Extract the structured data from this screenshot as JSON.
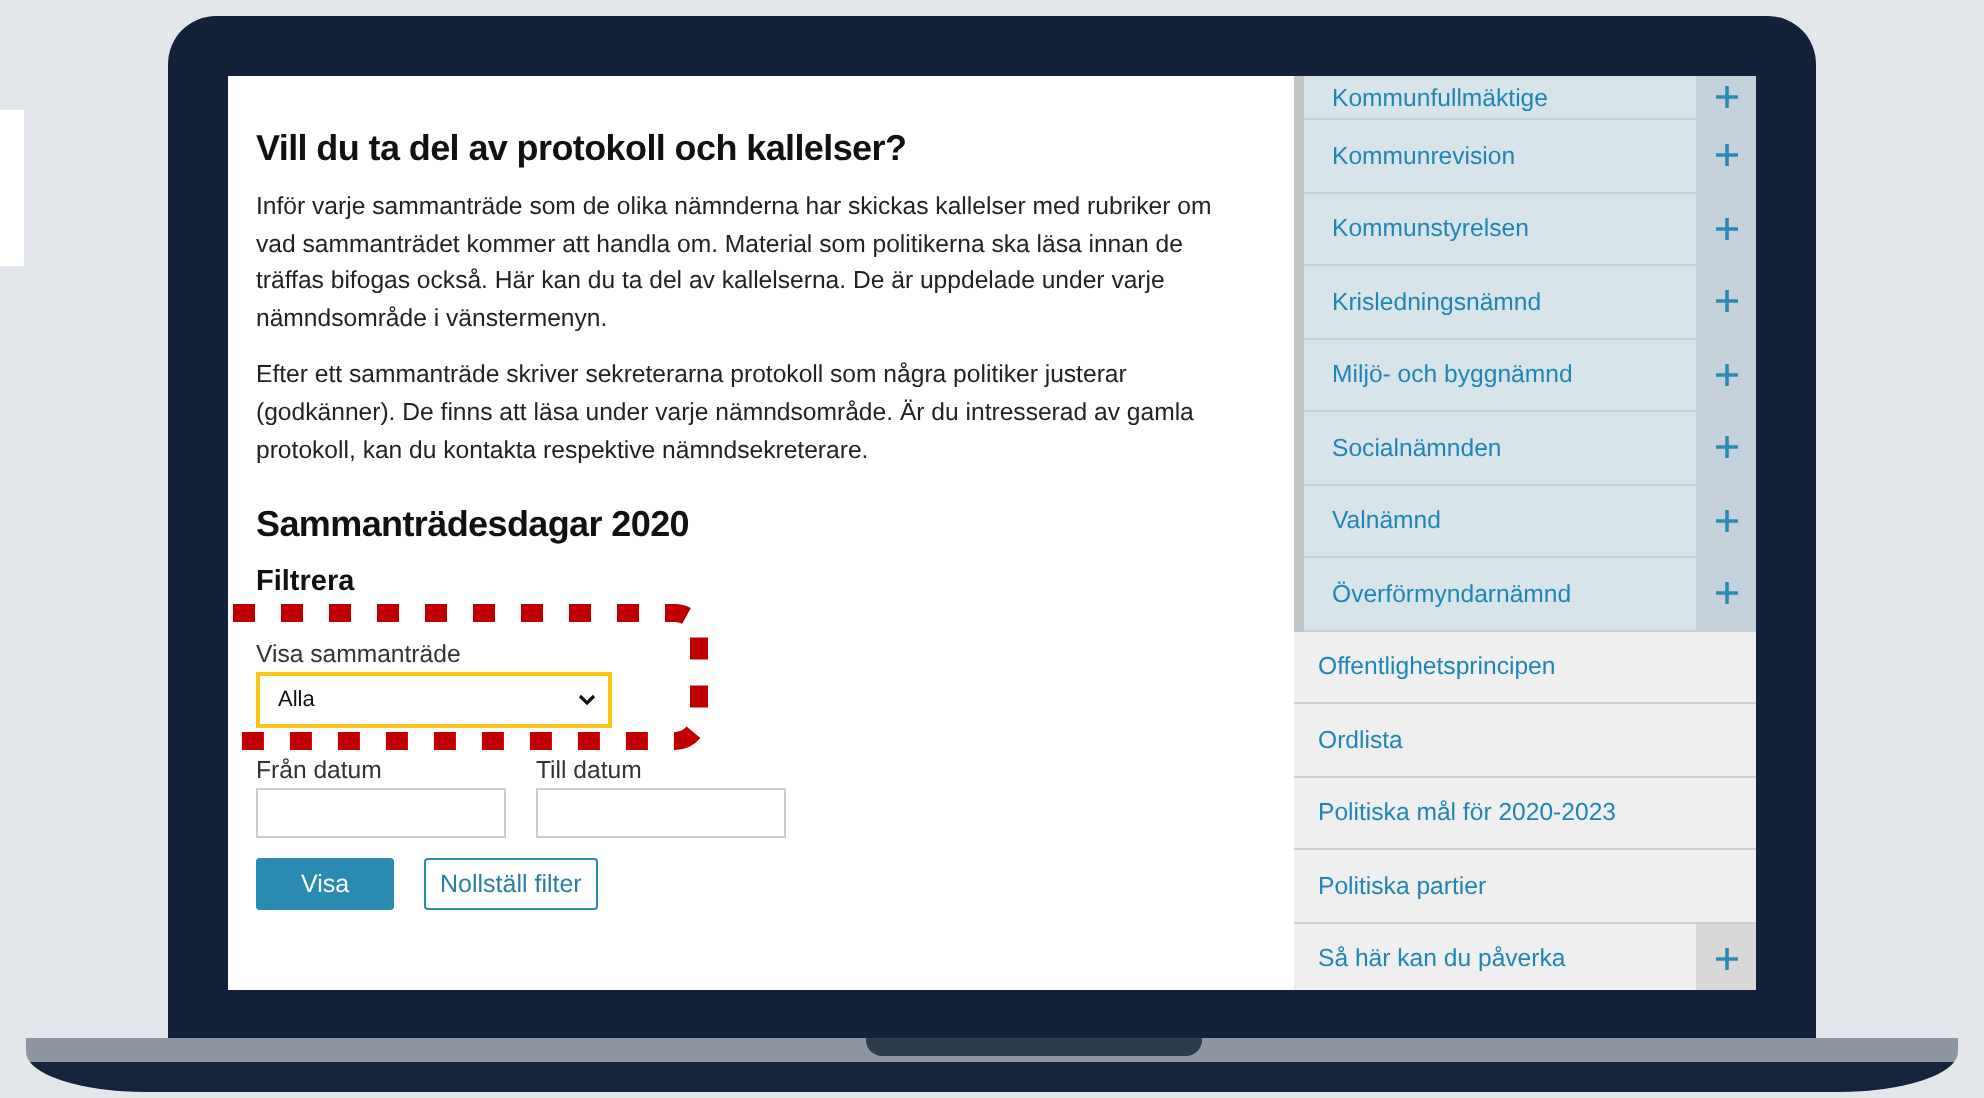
{
  "article": {
    "heading": "Vill du ta del av protokoll och kallelser?",
    "paragraphs": [
      "Inför varje sammanträde som de olika nämnderna har skickas kallelser med rubriker om vad sammanträdet kommer att handla om. Material som politikerna ska läsa innan de träffas bifogas också. Här kan du ta del av kallelserna. De är uppdelade under varje nämndsområde i vänstermenyn.",
      "Efter ett sammanträde skriver sekreterarna protokoll som några politiker justerar (godkänner). De finns att läsa under varje nämndsområde. Är du intresserad av gamla protokoll, kan du kontakta respektive nämndsekreterare."
    ]
  },
  "meetings": {
    "heading": "Sammanträdesdagar 2020",
    "filter_heading": "Filtrera",
    "select": {
      "label": "Visa sammanträde",
      "value": "Alla",
      "focused": true,
      "highlighted": true
    },
    "dates": [
      {
        "label": "Från datum"
      },
      {
        "label": "Till datum"
      }
    ],
    "buttons": [
      {
        "label": "Visa",
        "kind": "primary"
      },
      {
        "label": "Nollställ filter",
        "kind": "secondary"
      }
    ]
  },
  "sidebar": {
    "subitems": [
      {
        "label": "Kommunfullmäktige",
        "expandable": true
      },
      {
        "label": "Kommunrevision",
        "expandable": true
      },
      {
        "label": "Kommunstyrelsen",
        "expandable": true
      },
      {
        "label": "Krisledningsnämnd",
        "expandable": true
      },
      {
        "label": "Miljö- och byggnämnd",
        "expandable": true
      },
      {
        "label": "Socialnämnden",
        "expandable": true
      },
      {
        "label": "Valnämnd",
        "expandable": true
      },
      {
        "label": "Överförmyndarnämnd",
        "expandable": true
      }
    ],
    "items": [
      {
        "label": "Offentlighetsprincipen",
        "expandable": false
      },
      {
        "label": "Ordlista",
        "expandable": false
      },
      {
        "label": "Politiska mål för 2020-2023",
        "expandable": false
      },
      {
        "label": "Politiska partier",
        "expandable": false
      },
      {
        "label": "Så här kan du påverka",
        "expandable": true
      }
    ]
  }
}
